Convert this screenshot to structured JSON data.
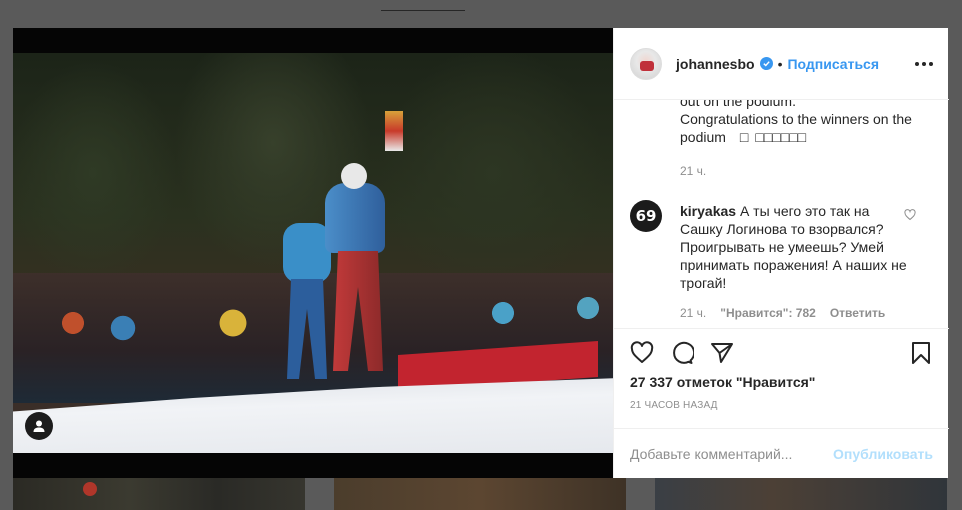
{
  "post": {
    "username": "johannesbo",
    "follow_label": "Подписаться",
    "caption_tail": "out on the podium.\nCongratulations to the winners on the podium □ □□□□□□",
    "caption_time": "21 ч.",
    "likes_text": "27 337 отметок \"Нравится\"",
    "posted_ago": "21 ЧАСОВ НАЗАД"
  },
  "comment": {
    "username": "kiryakas",
    "avatar_text": "69",
    "text": "А ты чего это так на Сашку Логинова то взорвался? Проигрывать не умеешь? Умей принимать поражения! А наших не трогай!",
    "time": "21 ч.",
    "likes": "\"Нравится\": 782",
    "reply_label": "Ответить"
  },
  "add_comment": {
    "placeholder": "Добавьте комментарий...",
    "publish_label": "Опубликовать"
  },
  "colors": {
    "accent": "#3897f0",
    "publish_disabled": "#b2dffc",
    "muted": "#8e8e8e"
  },
  "icons": [
    "verified-icon",
    "more-icon",
    "heart-icon",
    "comment-icon",
    "share-icon",
    "save-icon",
    "user-tag-icon",
    "comment-heart-icon"
  ]
}
